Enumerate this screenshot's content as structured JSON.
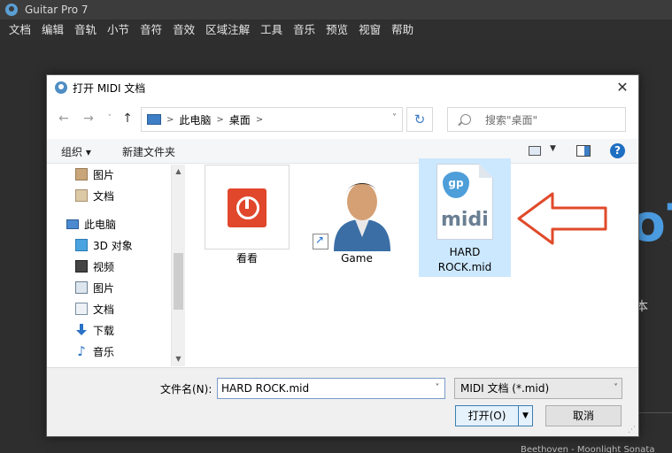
{
  "app": {
    "title": "Guitar Pro 7",
    "menu": [
      "文档",
      "编辑",
      "音轨",
      "小节",
      "音符",
      "音效",
      "区域注解",
      "工具",
      "音乐",
      "预览",
      "视窗",
      "帮助"
    ],
    "bg_logo_fragment": "o7",
    "bg_text_fragment": "本",
    "bg_bottom_fragment": "Beethoven - Moonlight Sonata"
  },
  "dialog": {
    "title": "打开 MIDI 文档",
    "close_glyph": "✕",
    "address": {
      "segments": [
        "此电脑",
        "桌面"
      ]
    },
    "search": {
      "placeholder": "搜索\"桌面\""
    },
    "toolbar": {
      "organize": "组织 ▾",
      "new_folder": "新建文件夹",
      "help": "?"
    },
    "nav_pane": {
      "items": [
        {
          "label": "图片",
          "icon": "pictures-icon"
        },
        {
          "label": "文档",
          "icon": "documents-icon"
        },
        {
          "label": "此电脑",
          "icon": "this-pc-icon"
        },
        {
          "label": "3D 对象",
          "icon": "3d-objects-icon"
        },
        {
          "label": "视频",
          "icon": "videos-icon"
        },
        {
          "label": "图片",
          "icon": "pictures-icon"
        },
        {
          "label": "文档",
          "icon": "documents-icon"
        },
        {
          "label": "下载",
          "icon": "downloads-icon"
        },
        {
          "label": "音乐",
          "icon": "music-icon"
        }
      ]
    },
    "files": [
      {
        "name": "看看",
        "icon": "kankan-app-icon",
        "selected": false
      },
      {
        "name": "Game",
        "icon": "user-avatar-shortcut-icon",
        "selected": false
      },
      {
        "name": "HARD ROCK.mid",
        "name_line1": "HARD",
        "name_line2": "ROCK.mid",
        "icon": "guitar-pro-midi-file-icon",
        "icon_text_pick": "gp",
        "icon_text_word": "midi",
        "selected": true
      }
    ],
    "bottom": {
      "filename_label": "文件名(N):",
      "filename_value": "HARD ROCK.mid",
      "filetype": "MIDI 文档 (*.mid)",
      "open_button": "打开(O)",
      "cancel_button": "取消"
    }
  },
  "colors": {
    "accent": "#4b9be0",
    "selection": "#cce8ff",
    "annotation_arrow": "#e04a2a"
  }
}
